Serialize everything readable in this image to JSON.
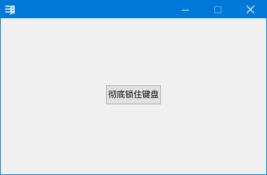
{
  "window": {
    "title": "",
    "app_icon": "app-logo-icon",
    "accent_color": "#0078d7",
    "controls": {
      "minimize_icon": "minimize-icon",
      "maximize_icon": "maximize-icon",
      "maximize_enabled": false,
      "close_icon": "close-icon"
    }
  },
  "main": {
    "lock_keyboard_label": "彻底锁住键盘"
  }
}
